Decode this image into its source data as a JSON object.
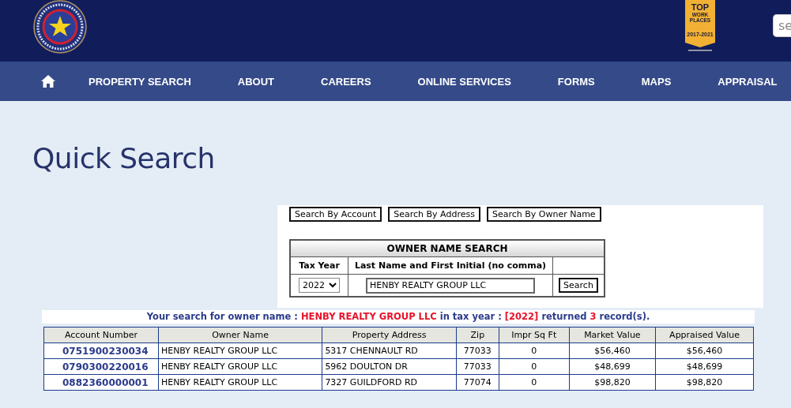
{
  "header": {
    "badge": {
      "lines": [
        "TOP",
        "WORK",
        "PLACES"
      ],
      "years": "2017-2021"
    },
    "search": {
      "placeholder": "se"
    }
  },
  "nav": {
    "items": [
      "PROPERTY SEARCH",
      "ABOUT",
      "CAREERS",
      "ONLINE SERVICES",
      "FORMS",
      "MAPS",
      "APPRAISAL"
    ]
  },
  "page_title": "Quick Search",
  "search_tabs": [
    "Search By Account",
    "Search By Address",
    "Search By Owner Name"
  ],
  "owner_search": {
    "title": "OWNER NAME SEARCH",
    "columns": [
      "Tax Year",
      "Last Name and First Initial (no comma)"
    ],
    "tax_year": "2022",
    "name_value": "HENBY REALTY GROUP LLC",
    "button": "Search"
  },
  "results": {
    "summary": [
      {
        "text": "Your search for owner name : ",
        "highlight": false
      },
      {
        "text": "HENBY REALTY GROUP LLC",
        "highlight": true
      },
      {
        "text": " in tax year : ",
        "highlight": false
      },
      {
        "text": "[2022]",
        "highlight": true
      },
      {
        "text": " returned ",
        "highlight": false
      },
      {
        "text": "3",
        "highlight": true
      },
      {
        "text": " record(s).",
        "highlight": false
      }
    ],
    "columns": [
      "Account Number",
      "Owner Name",
      "Property Address",
      "Zip",
      "Impr Sq Ft",
      "Market Value",
      "Appraised Value"
    ],
    "rows": [
      {
        "account": "0751900230034",
        "owner": "HENBY REALTY GROUP LLC",
        "address": "5317 CHENNAULT RD",
        "zip": "77033",
        "impr_sq_ft": "0",
        "market_value": "$56,460",
        "appraised_value": "$56,460"
      },
      {
        "account": "0790300220016",
        "owner": "HENBY REALTY GROUP LLC",
        "address": "5962 DOULTON DR",
        "zip": "77033",
        "impr_sq_ft": "0",
        "market_value": "$48,699",
        "appraised_value": "$48,699"
      },
      {
        "account": "0882360000001",
        "owner": "HENBY REALTY GROUP LLC",
        "address": "7327 GUILDFORD RD",
        "zip": "77074",
        "impr_sq_ft": "0",
        "market_value": "$98,820",
        "appraised_value": "$98,820"
      }
    ]
  }
}
